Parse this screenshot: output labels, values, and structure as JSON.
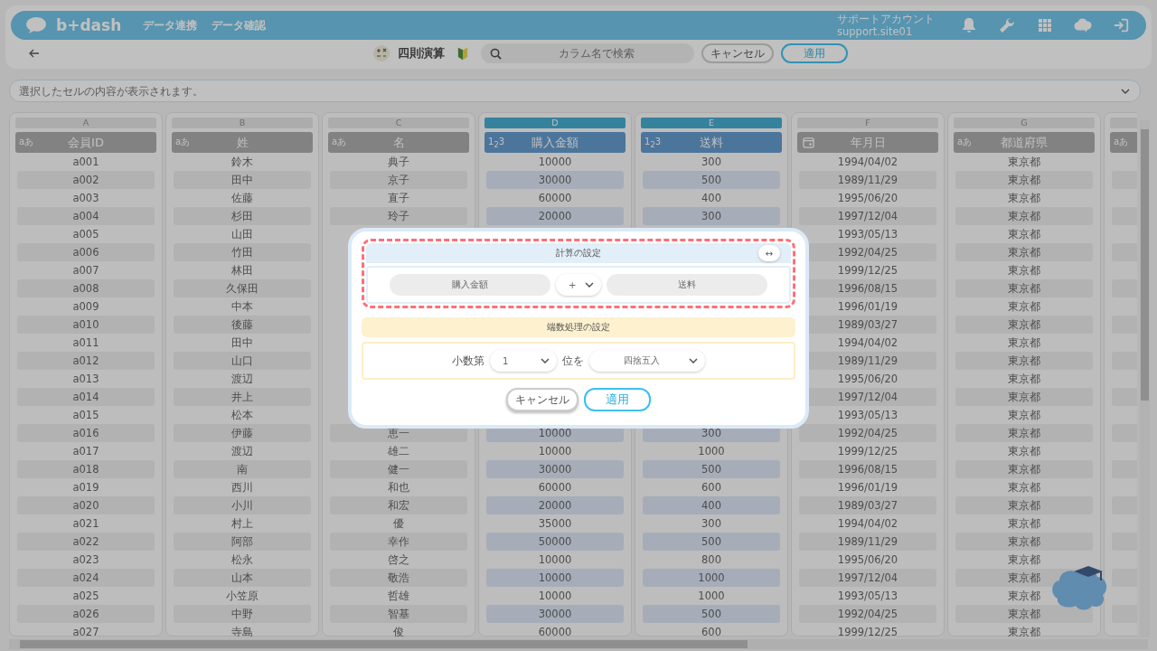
{
  "app_bar": {
    "logo": "b+dash",
    "nav": [
      "データ連携",
      "データ確認"
    ],
    "account_name": "サポートアカウント",
    "account_id": "support.site01"
  },
  "toolbar": {
    "title": "四則演算",
    "search": {
      "placeholder": "カラム名で検索"
    },
    "buttons": [
      {
        "label": "キャンセル",
        "kind": "secondary"
      },
      {
        "label": "適用",
        "kind": "primary"
      }
    ]
  },
  "cell_content_bar": {
    "placeholder": "選択したセルの内容が表示されます。"
  },
  "columns": [
    {
      "letter": "A",
      "name": "会員ID",
      "kind": "text",
      "type_label": "aあ",
      "selected": false,
      "cells": [
        "a001",
        "a002",
        "a003",
        "a004",
        "a005",
        "a006",
        "a007",
        "a008",
        "a009",
        "a010",
        "a011",
        "a012",
        "a013",
        "a014",
        "a015",
        "a016",
        "a017",
        "a018",
        "a019",
        "a020",
        "a021",
        "a022",
        "a023",
        "a024",
        "a025",
        "a026",
        "a027"
      ]
    },
    {
      "letter": "B",
      "name": "姓",
      "kind": "text",
      "type_label": "aあ",
      "selected": false,
      "cells": [
        "鈴木",
        "田中",
        "佐藤",
        "杉田",
        "山田",
        "竹田",
        "林田",
        "久保田",
        "中本",
        "後藤",
        "田中",
        "山口",
        "渡辺",
        "井上",
        "松本",
        "伊藤",
        "渡辺",
        "南",
        "西川",
        "小川",
        "村上",
        "阿部",
        "松永",
        "山本",
        "小笠原",
        "中野",
        "寺島"
      ]
    },
    {
      "letter": "C",
      "name": "名",
      "kind": "text",
      "type_label": "aあ",
      "selected": false,
      "cells": [
        "典子",
        "京子",
        "直子",
        "玲子",
        null,
        null,
        null,
        null,
        null,
        null,
        null,
        null,
        null,
        null,
        null,
        "恵一",
        "雄二",
        "健一",
        "和也",
        "和宏",
        "優",
        "幸作",
        "啓之",
        "敬浩",
        "哲雄",
        "智基",
        "俊"
      ]
    },
    {
      "letter": "D",
      "name": "購入金額",
      "kind": "number",
      "type_label": "1$_{2}$3",
      "selected": true,
      "cells": [
        "10000",
        "30000",
        "60000",
        "20000",
        null,
        null,
        null,
        null,
        null,
        null,
        null,
        null,
        null,
        null,
        null,
        "10000",
        "10000",
        "30000",
        "60000",
        "20000",
        "35000",
        "50000",
        "10000",
        "10000",
        "10000",
        "30000",
        "60000"
      ]
    },
    {
      "letter": "E",
      "name": "送料",
      "kind": "number",
      "type_label": "1$_{2}$3",
      "selected": true,
      "cells": [
        "300",
        "500",
        "400",
        "300",
        null,
        null,
        null,
        null,
        null,
        null,
        null,
        null,
        null,
        null,
        null,
        "300",
        "1000",
        "500",
        "600",
        "400",
        "300",
        "500",
        "800",
        "1000",
        "1000",
        "500",
        "600"
      ]
    },
    {
      "letter": "F",
      "name": "年月日",
      "kind": "date",
      "selected": false,
      "cells": [
        "1994/04/02",
        "1989/11/29",
        "1995/06/20",
        "1997/12/04",
        "1993/05/13",
        "1992/04/25",
        "1999/12/25",
        "1996/08/15",
        "1996/01/19",
        "1989/03/27",
        "1994/04/02",
        "1989/11/29",
        "1995/06/20",
        "1997/12/04",
        "1993/05/13",
        "1992/04/25",
        "1999/12/25",
        "1996/08/15",
        "1996/01/19",
        "1989/03/27",
        "1994/04/02",
        "1989/11/29",
        "1995/06/20",
        "1997/12/04",
        "1993/05/13",
        "1992/04/25",
        "1999/12/25"
      ]
    },
    {
      "letter": "G",
      "name": "都道府県",
      "kind": "text",
      "type_label": "aあ",
      "selected": false,
      "cells": [
        "東京都",
        "東京都",
        "東京都",
        "東京都",
        "東京都",
        "東京都",
        "東京都",
        "東京都",
        "東京都",
        "東京都",
        "東京都",
        "東京都",
        "東京都",
        "東京都",
        "東京都",
        "東京都",
        "東京都",
        "東京都",
        "東京都",
        "東京都",
        "東京都",
        "東京都",
        "東京都",
        "東京都",
        "東京都",
        "東京都",
        "東京都"
      ]
    },
    {
      "kind": "text",
      "type_label": "aあ",
      "selected": false
    }
  ],
  "dialog": {
    "calc_title": "計算の設定",
    "swap": "↔",
    "left_operand": "購入金額",
    "operator": "+",
    "right_operand": "送料",
    "rounding_title": "端数処理の設定",
    "decimal_prefix": "小数第",
    "digit": "1",
    "decimal_suffix": "位を",
    "method": "四捨五入",
    "buttons": [
      {
        "label": "キャンセル",
        "kind": "secondary"
      },
      {
        "label": "適用",
        "kind": "primary"
      }
    ]
  }
}
